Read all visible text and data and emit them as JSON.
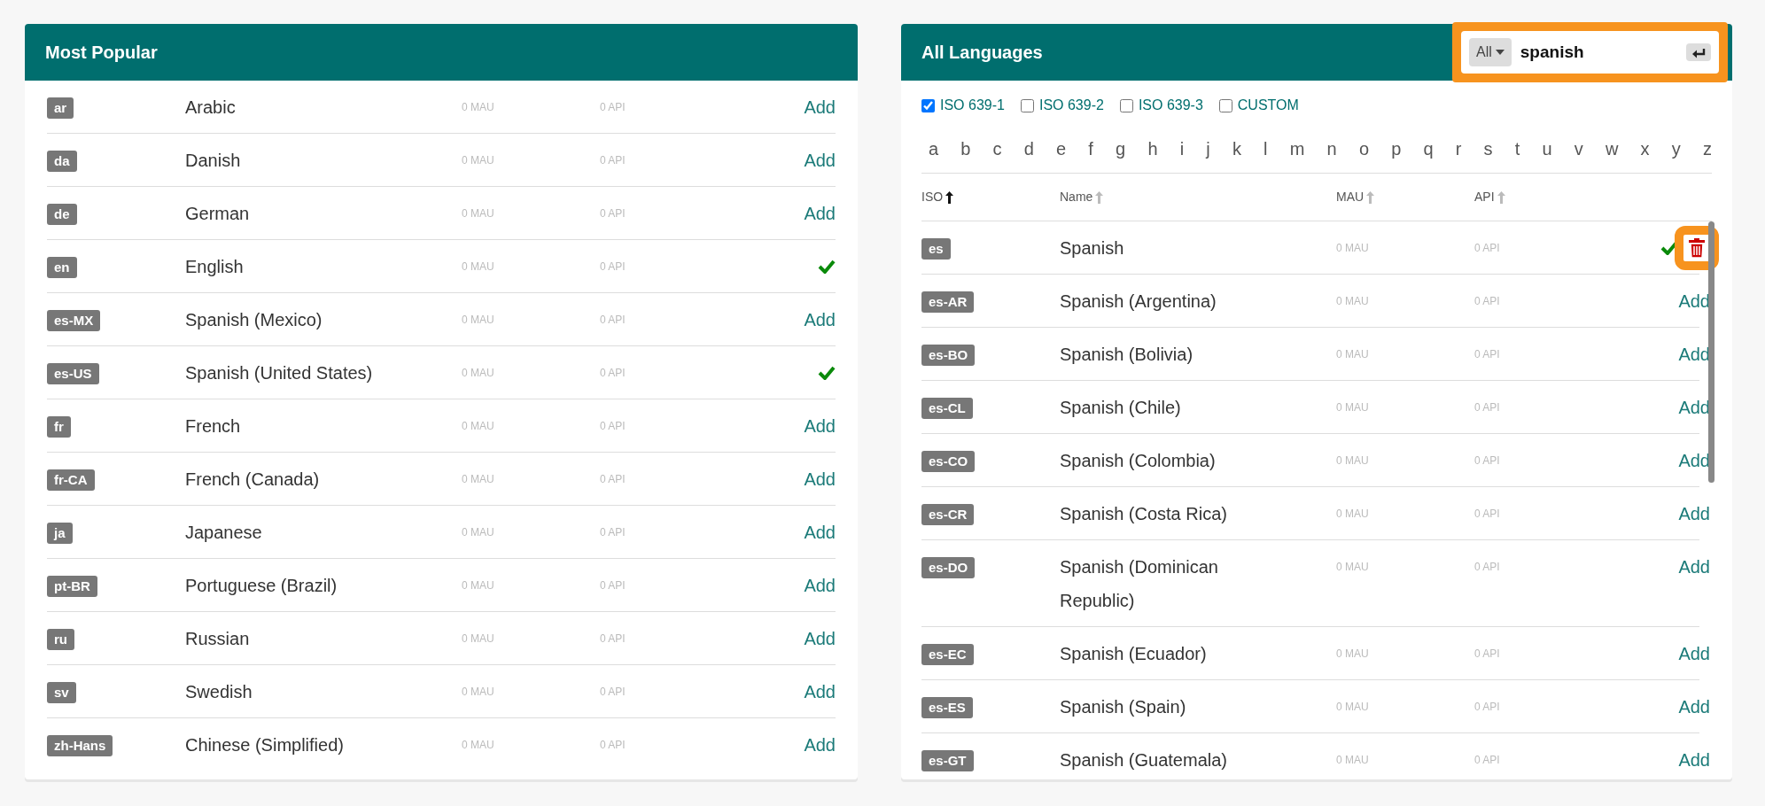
{
  "popular": {
    "title": "Most Popular",
    "rows": [
      {
        "code": "ar",
        "name": "Arabic",
        "mau": "0 MAU",
        "api": "0 API",
        "added": false,
        "action": "Add"
      },
      {
        "code": "da",
        "name": "Danish",
        "mau": "0 MAU",
        "api": "0 API",
        "added": false,
        "action": "Add"
      },
      {
        "code": "de",
        "name": "German",
        "mau": "0 MAU",
        "api": "0 API",
        "added": false,
        "action": "Add"
      },
      {
        "code": "en",
        "name": "English",
        "mau": "0 MAU",
        "api": "0 API",
        "added": true
      },
      {
        "code": "es-MX",
        "name": "Spanish (Mexico)",
        "mau": "0 MAU",
        "api": "0 API",
        "added": false,
        "action": "Add"
      },
      {
        "code": "es-US",
        "name": "Spanish (United States)",
        "mau": "0 MAU",
        "api": "0 API",
        "added": true
      },
      {
        "code": "fr",
        "name": "French",
        "mau": "0 MAU",
        "api": "0 API",
        "added": false,
        "action": "Add"
      },
      {
        "code": "fr-CA",
        "name": "French (Canada)",
        "mau": "0 MAU",
        "api": "0 API",
        "added": false,
        "action": "Add"
      },
      {
        "code": "ja",
        "name": "Japanese",
        "mau": "0 MAU",
        "api": "0 API",
        "added": false,
        "action": "Add"
      },
      {
        "code": "pt-BR",
        "name": "Portuguese (Brazil)",
        "mau": "0 MAU",
        "api": "0 API",
        "added": false,
        "action": "Add"
      },
      {
        "code": "ru",
        "name": "Russian",
        "mau": "0 MAU",
        "api": "0 API",
        "added": false,
        "action": "Add"
      },
      {
        "code": "sv",
        "name": "Swedish",
        "mau": "0 MAU",
        "api": "0 API",
        "added": false,
        "action": "Add"
      },
      {
        "code": "zh-Hans",
        "name": "Chinese (Simplified)",
        "mau": "0 MAU",
        "api": "0 API",
        "added": false,
        "action": "Add"
      }
    ]
  },
  "all": {
    "title": "All Languages",
    "search": {
      "scope": "All",
      "value": "spanish",
      "highlighted": true
    },
    "filters": [
      {
        "label": "ISO 639-1",
        "checked": true
      },
      {
        "label": "ISO 639-2",
        "checked": false
      },
      {
        "label": "ISO 639-3",
        "checked": false
      },
      {
        "label": "CUSTOM",
        "checked": false
      }
    ],
    "letters": [
      "a",
      "b",
      "c",
      "d",
      "e",
      "f",
      "g",
      "h",
      "i",
      "j",
      "k",
      "l",
      "m",
      "n",
      "o",
      "p",
      "q",
      "r",
      "s",
      "t",
      "u",
      "v",
      "w",
      "x",
      "y",
      "z"
    ],
    "columns": [
      {
        "label": "ISO",
        "selected": true
      },
      {
        "label": "Name",
        "selected": false
      },
      {
        "label": "MAU",
        "selected": false
      },
      {
        "label": "API",
        "selected": false
      }
    ],
    "rows": [
      {
        "code": "es",
        "name": "Spanish",
        "mau": "0 MAU",
        "api": "0 API",
        "added": true,
        "highlighted": true
      },
      {
        "code": "es-AR",
        "name": "Spanish (Argentina)",
        "mau": "0 MAU",
        "api": "0 API",
        "added": false,
        "action": "Add"
      },
      {
        "code": "es-BO",
        "name": "Spanish (Bolivia)",
        "mau": "0 MAU",
        "api": "0 API",
        "added": false,
        "action": "Add"
      },
      {
        "code": "es-CL",
        "name": "Spanish (Chile)",
        "mau": "0 MAU",
        "api": "0 API",
        "added": false,
        "action": "Add"
      },
      {
        "code": "es-CO",
        "name": "Spanish (Colombia)",
        "mau": "0 MAU",
        "api": "0 API",
        "added": false,
        "action": "Add"
      },
      {
        "code": "es-CR",
        "name": "Spanish (Costa Rica)",
        "mau": "0 MAU",
        "api": "0 API",
        "added": false,
        "action": "Add"
      },
      {
        "code": "es-DO",
        "name": "Spanish (Dominican Republic)",
        "mau": "0 MAU",
        "api": "0 API",
        "added": false,
        "action": "Add"
      },
      {
        "code": "es-EC",
        "name": "Spanish (Ecuador)",
        "mau": "0 MAU",
        "api": "0 API",
        "added": false,
        "action": "Add"
      },
      {
        "code": "es-ES",
        "name": "Spanish (Spain)",
        "mau": "0 MAU",
        "api": "0 API",
        "added": false,
        "action": "Add"
      },
      {
        "code": "es-GT",
        "name": "Spanish (Guatemala)",
        "mau": "0 MAU",
        "api": "0 API",
        "added": false,
        "action": "Add"
      }
    ]
  }
}
